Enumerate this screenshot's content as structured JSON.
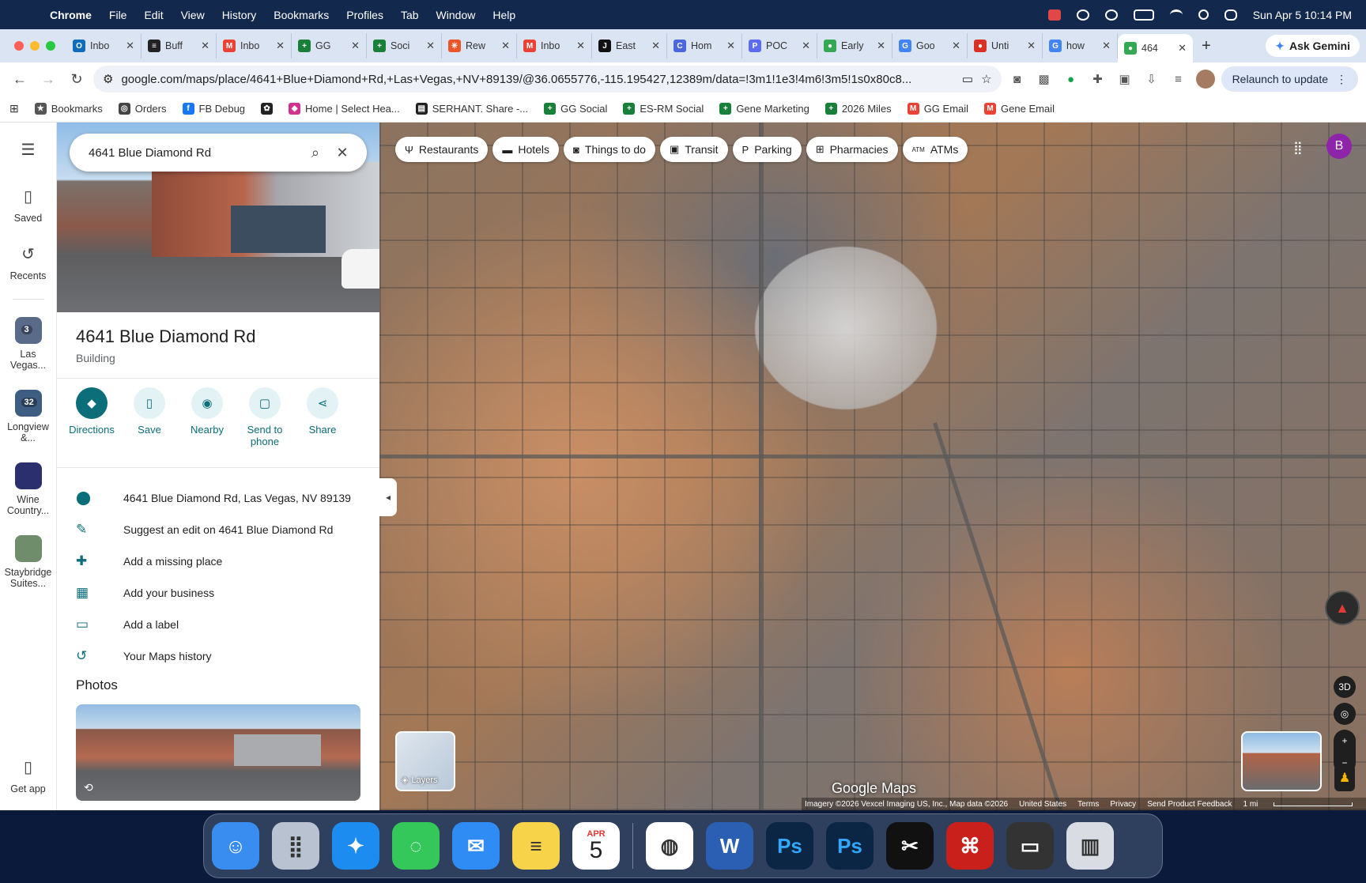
{
  "menubar": {
    "app": "Chrome",
    "items": [
      "File",
      "Edit",
      "View",
      "History",
      "Bookmarks",
      "Profiles",
      "Tab",
      "Window",
      "Help"
    ],
    "clock": "Sun Apr 5  10:14 PM"
  },
  "tabs": [
    {
      "label": "Inbo",
      "icon": "outlook-icon",
      "color": "#0f6cbd",
      "glyph": "O"
    },
    {
      "label": "Buff",
      "icon": "buffer-icon",
      "color": "#222222",
      "glyph": "≡"
    },
    {
      "label": "Inbo",
      "icon": "gmail-icon",
      "color": "#ea4335",
      "glyph": "M"
    },
    {
      "label": "GG",
      "icon": "sheets-icon",
      "color": "#188038",
      "glyph": "+"
    },
    {
      "label": "Soci",
      "icon": "sheets-icon",
      "color": "#188038",
      "glyph": "+"
    },
    {
      "label": "Rew",
      "icon": "asterisk-icon",
      "color": "#e8562a",
      "glyph": "✳"
    },
    {
      "label": "Inbo",
      "icon": "gmail-icon",
      "color": "#ea4335",
      "glyph": "M"
    },
    {
      "label": "East",
      "icon": "app-icon",
      "color": "#111111",
      "glyph": "J"
    },
    {
      "label": "Hom",
      "icon": "globe-icon",
      "color": "#4a67e0",
      "glyph": "C"
    },
    {
      "label": "POC",
      "icon": "app-icon",
      "color": "#5b6cf0",
      "glyph": "P"
    },
    {
      "label": "Early",
      "icon": "maps-pin-icon",
      "color": "#34a853",
      "glyph": "●"
    },
    {
      "label": "Goo",
      "icon": "google-icon",
      "color": "#4285f4",
      "glyph": "G"
    },
    {
      "label": "Unti",
      "icon": "maps-pin-icon",
      "color": "#d93025",
      "glyph": "●"
    },
    {
      "label": "how",
      "icon": "google-icon",
      "color": "#4285f4",
      "glyph": "G"
    },
    {
      "label": "464",
      "icon": "maps-pin-icon",
      "color": "#34a853",
      "glyph": "●",
      "active": true
    }
  ],
  "gemini_label": "Ask Gemini",
  "omnibox": {
    "url": "google.com/maps/place/4641+Blue+Diamond+Rd,+Las+Vegas,+NV+89139/@36.0655776,-115.195427,12389m/data=!3m1!1e3!4m6!3m5!1s0x80c8..."
  },
  "relaunch_label": "Relaunch to update",
  "bookmarks": [
    {
      "label": "Bookmarks",
      "icon": "star-icon",
      "color": "#555555",
      "glyph": "★"
    },
    {
      "label": "Orders",
      "icon": "globe-icon",
      "color": "#444444",
      "glyph": "◎"
    },
    {
      "label": "FB Debug",
      "icon": "facebook-icon",
      "color": "#1877f2",
      "glyph": "f"
    },
    {
      "label": "",
      "icon": "openai-icon",
      "color": "#222222",
      "glyph": "✿"
    },
    {
      "label": "Home | Select Hea...",
      "icon": "diamond-icon",
      "color": "#d0338f",
      "glyph": "◆"
    },
    {
      "label": "SERHANT. Share -...",
      "icon": "doc-icon",
      "color": "#222222",
      "glyph": "▤"
    },
    {
      "label": "GG Social",
      "icon": "sheets-icon",
      "color": "#188038",
      "glyph": "+"
    },
    {
      "label": "ES-RM Social",
      "icon": "sheets-icon",
      "color": "#188038",
      "glyph": "+"
    },
    {
      "label": "Gene Marketing",
      "icon": "sheets-icon",
      "color": "#188038",
      "glyph": "+"
    },
    {
      "label": "2026 Miles",
      "icon": "sheets-icon",
      "color": "#188038",
      "glyph": "+"
    },
    {
      "label": "GG Email",
      "icon": "gmail-icon",
      "color": "#ea4335",
      "glyph": "M"
    },
    {
      "label": "Gene Email",
      "icon": "gmail-icon",
      "color": "#ea4335",
      "glyph": "M"
    }
  ],
  "rail": {
    "saved": "Saved",
    "recents": "Recents",
    "places": [
      {
        "label": "Las Vegas...",
        "count": "3",
        "color": "#5a6b8a"
      },
      {
        "label": "Longview &...",
        "count": "32",
        "color": "#3e5d82"
      },
      {
        "label": "Wine Country...",
        "count": "",
        "color": "#2c2f6e"
      },
      {
        "label": "Staybridge Suites...",
        "count": "",
        "color": "#6f8d6a"
      }
    ],
    "get_app": "Get app"
  },
  "search": {
    "value": "4641 Blue Diamond Rd"
  },
  "place": {
    "title": "4641 Blue Diamond Rd",
    "category": "Building",
    "actions": [
      {
        "label": "Directions",
        "icon": "directions-icon",
        "glyph": "◆"
      },
      {
        "label": "Save",
        "icon": "bookmark-icon",
        "glyph": "▯"
      },
      {
        "label": "Nearby",
        "icon": "nearby-icon",
        "glyph": "◉"
      },
      {
        "label": "Send to phone",
        "icon": "phone-icon",
        "glyph": "▢"
      },
      {
        "label": "Share",
        "icon": "share-icon",
        "glyph": "⋖"
      }
    ],
    "info": [
      {
        "text": "4641 Blue Diamond Rd, Las Vegas, NV 89139",
        "icon": "location-pin-icon",
        "glyph": "⬤"
      },
      {
        "text": "Suggest an edit on 4641 Blue Diamond Rd",
        "icon": "pencil-icon",
        "glyph": "✎"
      },
      {
        "text": "Add a missing place",
        "icon": "add-place-icon",
        "glyph": "✚"
      },
      {
        "text": "Add your business",
        "icon": "storefront-icon",
        "glyph": "▦"
      },
      {
        "text": "Add a label",
        "icon": "label-icon",
        "glyph": "▭"
      },
      {
        "text": "Your Maps history",
        "icon": "history-icon",
        "glyph": "↺"
      }
    ],
    "photos_heading": "Photos"
  },
  "map": {
    "chips": [
      {
        "label": "Restaurants",
        "icon": "fork-knife-icon",
        "glyph": "Ψ"
      },
      {
        "label": "Hotels",
        "icon": "bed-icon",
        "glyph": "▬"
      },
      {
        "label": "Things to do",
        "icon": "camera-icon",
        "glyph": "◙"
      },
      {
        "label": "Transit",
        "icon": "bus-icon",
        "glyph": "▣"
      },
      {
        "label": "Parking",
        "icon": "parking-icon",
        "glyph": "P"
      },
      {
        "label": "Pharmacies",
        "icon": "pharmacy-icon",
        "glyph": "⊞"
      },
      {
        "label": "ATMs",
        "icon": "atm-icon",
        "glyph": "ATM"
      }
    ],
    "avatar_letter": "B",
    "layers_label": "Layers",
    "logo": "Google Maps",
    "attribution": [
      "Imagery ©2026 Vexcel Imaging US, Inc., Map data ©2026",
      "United States",
      "Terms",
      "Privacy",
      "Send Product Feedback",
      "1 mi"
    ],
    "three_d": "3D"
  },
  "dock": {
    "calendar_month": "APR",
    "calendar_day": "5",
    "apps": [
      {
        "name": "finder-icon",
        "color": "#3a8df0",
        "glyph": "☺"
      },
      {
        "name": "launchpad-icon",
        "color": "#b9c2d0",
        "glyph": "⣿"
      },
      {
        "name": "safari-icon",
        "color": "#1d8cf0",
        "glyph": "✦"
      },
      {
        "name": "messages-icon",
        "color": "#34c759",
        "glyph": "◌"
      },
      {
        "name": "mail-icon",
        "color": "#2f8cf5",
        "glyph": "✉"
      },
      {
        "name": "notes-icon",
        "color": "#f7d34a",
        "glyph": "≡"
      }
    ],
    "apps2": [
      {
        "name": "chrome-icon",
        "color": "#ffffff",
        "glyph": "◍"
      },
      {
        "name": "word-icon",
        "color": "#2b5fb4",
        "glyph": "W"
      },
      {
        "name": "photoshop-icon",
        "color": "#0b2545",
        "glyph": "Ps"
      },
      {
        "name": "photoshop-beta-icon",
        "color": "#0b2545",
        "glyph": "Ps"
      },
      {
        "name": "capcut-icon",
        "color": "#111111",
        "glyph": "✂"
      },
      {
        "name": "acrobat-icon",
        "color": "#c9201c",
        "glyph": "⌘"
      },
      {
        "name": "screenshot-icon",
        "color": "#333333",
        "glyph": "▭"
      },
      {
        "name": "trash-icon",
        "color": "#d9dde3",
        "glyph": "▥"
      }
    ]
  }
}
